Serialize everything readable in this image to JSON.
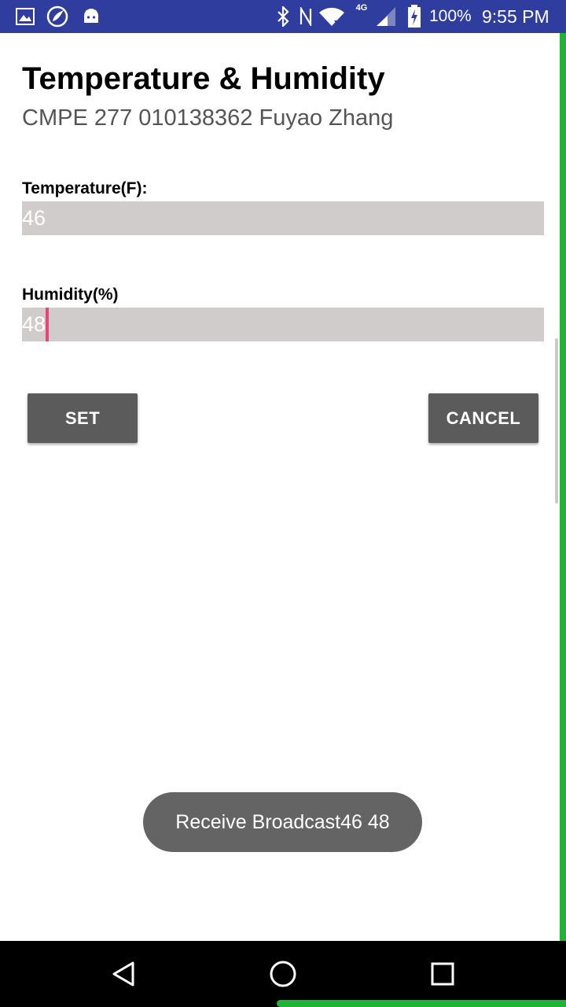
{
  "status_bar": {
    "battery_percent": "100%",
    "time": "9:55 PM",
    "network_label": "4G",
    "icons": [
      "image-icon",
      "app-notification-icon",
      "android-icon",
      "bluetooth-icon",
      "nfc-icon",
      "wifi-icon",
      "signal-icon",
      "battery-charging-icon"
    ]
  },
  "header": {
    "title": "Temperature & Humidity",
    "subtitle": "CMPE 277 010138362 Fuyao Zhang"
  },
  "form": {
    "temperature_label": "Temperature(F):",
    "temperature_value": "46",
    "humidity_label": "Humidity(%)",
    "humidity_value": "48"
  },
  "buttons": {
    "set_label": "SET",
    "cancel_label": "CANCEL"
  },
  "toast": {
    "message": "Receive Broadcast46 48"
  },
  "nav": {
    "icons": [
      "back-icon",
      "home-icon",
      "recents-icon"
    ]
  },
  "colors": {
    "status_bar": "#2f3e9e",
    "button": "#5b5b5b",
    "input_bg": "#cfcccb",
    "cursor": "#e8437a",
    "accent_green": "#1db533"
  }
}
